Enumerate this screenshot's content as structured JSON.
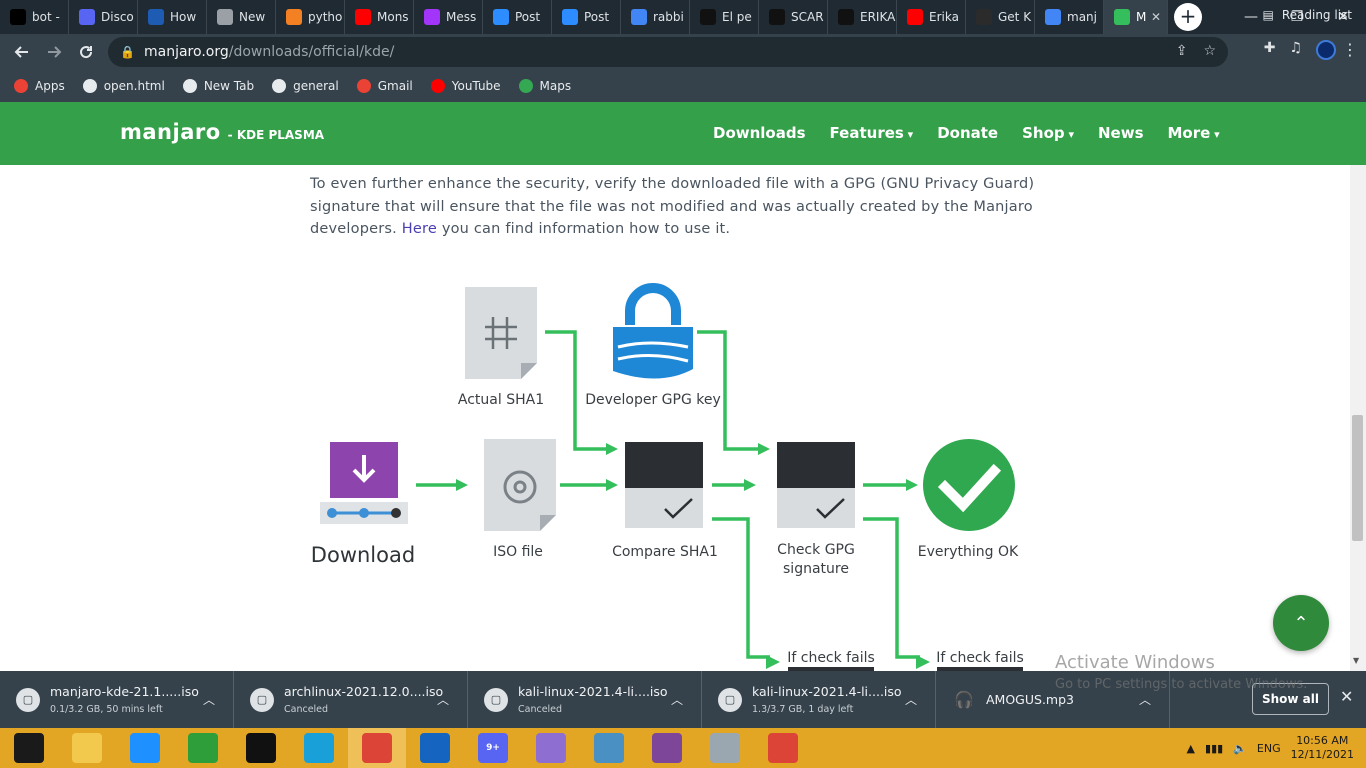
{
  "browser": {
    "tabs": [
      {
        "label": "bot -",
        "icon": "threads-icon",
        "color": "#000000"
      },
      {
        "label": "Disco",
        "icon": "discord-icon",
        "color": "#5865f2"
      },
      {
        "label": "How",
        "icon": "el-icon",
        "color": "#1e5cb3"
      },
      {
        "label": "New",
        "icon": "chrome-icon",
        "color": "#9aa0a6"
      },
      {
        "label": "pytho",
        "icon": "stackoverflow-icon",
        "color": "#f48024"
      },
      {
        "label": "Mons",
        "icon": "youtube-icon",
        "color": "#ff0000"
      },
      {
        "label": "Mess",
        "icon": "messenger-icon",
        "color": "#a334fa"
      },
      {
        "label": "Post",
        "icon": "zoom-icon",
        "color": "#2d8cff"
      },
      {
        "label": "Post",
        "icon": "zoom-icon",
        "color": "#2d8cff"
      },
      {
        "label": "rabbi",
        "icon": "google-icon",
        "color": "#4285f4"
      },
      {
        "label": "El pe",
        "icon": "tiktok-icon",
        "color": "#111111"
      },
      {
        "label": "SCAR",
        "icon": "tiktok-icon",
        "color": "#111111"
      },
      {
        "label": "ERIKA",
        "icon": "tiktok-icon",
        "color": "#111111"
      },
      {
        "label": "Erika",
        "icon": "youtube-icon",
        "color": "#ff0000"
      },
      {
        "label": "Get K",
        "icon": "kali-icon",
        "color": "#2b2b2b"
      },
      {
        "label": "manj",
        "icon": "google-icon",
        "color": "#4285f4"
      },
      {
        "label": "M",
        "icon": "manjaro-icon",
        "color": "#35bf5c"
      }
    ],
    "new_tab_symbol": "+",
    "window_controls": {
      "minimize": "—",
      "restore": "❐",
      "close": "✕"
    },
    "url_host": "manjaro.org",
    "url_path": "/downloads/official/kde/",
    "bookmarks": [
      {
        "label": "Apps",
        "icon": "apps-grid-icon"
      },
      {
        "label": "open.html",
        "icon": "globe-icon"
      },
      {
        "label": "New Tab",
        "icon": "globe-icon"
      },
      {
        "label": "general",
        "icon": "globe-icon"
      },
      {
        "label": "Gmail",
        "icon": "gmail-icon"
      },
      {
        "label": "YouTube",
        "icon": "youtube-icon"
      },
      {
        "label": "Maps",
        "icon": "maps-icon"
      }
    ],
    "reading_list": "Reading list"
  },
  "site": {
    "logo": "manjaro",
    "edition": "- KDE PLASMA",
    "nav": [
      {
        "label": "Downloads",
        "dropdown": false
      },
      {
        "label": "Features",
        "dropdown": true
      },
      {
        "label": "Donate",
        "dropdown": false
      },
      {
        "label": "Shop",
        "dropdown": true
      },
      {
        "label": "News",
        "dropdown": false
      },
      {
        "label": "More",
        "dropdown": true
      }
    ]
  },
  "content": {
    "intro_text": "To even further enhance the security, verify the downloaded file with a GPG (GNU Privacy Guard) signature that will ensure that the file was not modified and was actually created by the Manjaro developers.",
    "intro_link": "Here",
    "intro_suffix": "you can find information how to use it.",
    "diagram": {
      "download": "Download",
      "iso_file": "ISO file",
      "actual_sha1": "Actual SHA1",
      "developer_key": "Developer GPG key",
      "compare_sha1": "Compare SHA1",
      "check_gpg_line1": "Check GPG",
      "check_gpg_line2": "signature",
      "everything_ok": "Everything OK",
      "if_check_fails": "If check fails"
    }
  },
  "scroll_top_symbol": "⌃",
  "watermark": {
    "title": "Activate Windows",
    "subtitle": "Go to PC settings to activate Windows."
  },
  "downloads": {
    "items": [
      {
        "name": "manjaro-kde-21.1.....iso",
        "status": "0.1/3.2 GB, 50 mins left",
        "icon": "file-icon"
      },
      {
        "name": "archlinux-2021.12.0....iso",
        "status": "Canceled",
        "icon": "file-icon"
      },
      {
        "name": "kali-linux-2021.4-li....iso",
        "status": "Canceled",
        "icon": "file-icon"
      },
      {
        "name": "kali-linux-2021.4-li....iso",
        "status": "1.3/3.7 GB, 1 day left",
        "icon": "file-icon"
      },
      {
        "name": "AMOGUS.mp3",
        "status": "",
        "icon": "audio-file-icon"
      }
    ],
    "show_all": "Show all",
    "close": "✕"
  },
  "taskbar": {
    "apps": [
      {
        "icon": "windows-start-icon",
        "color": "#1a1a1a"
      },
      {
        "icon": "file-explorer-icon",
        "color": "#f2c94c"
      },
      {
        "icon": "internet-explorer-icon",
        "color": "#1e90ff"
      },
      {
        "icon": "store-icon",
        "color": "#2e9e3a"
      },
      {
        "icon": "command-prompt-icon",
        "color": "#111111"
      },
      {
        "icon": "edge-icon",
        "color": "#1aa0d8"
      },
      {
        "icon": "chrome-icon",
        "color": "#db4437"
      },
      {
        "icon": "defender-icon",
        "color": "#1565c0"
      },
      {
        "icon": "discord-icon",
        "color": "#5865f2"
      },
      {
        "icon": "paint-icon",
        "color": "#8e6fd1"
      },
      {
        "icon": "remote-desktop-icon",
        "color": "#4a90c2"
      },
      {
        "icon": "tor-browser-icon",
        "color": "#7d4698"
      },
      {
        "icon": "task-manager-icon",
        "color": "#9aa7b0"
      },
      {
        "icon": "chrome-icon",
        "color": "#db4437"
      }
    ],
    "discord_badge": "9+",
    "language": "ENG",
    "time": "10:56 AM",
    "date": "12/11/2021"
  },
  "colors": {
    "manjaro_green": "#35a04a",
    "arrow_green": "#35bf5c",
    "ok_green": "#2fa84f",
    "gpg_blue": "#1e88d6",
    "download_purple": "#8e44ad",
    "taskbar": "#e3a524"
  }
}
